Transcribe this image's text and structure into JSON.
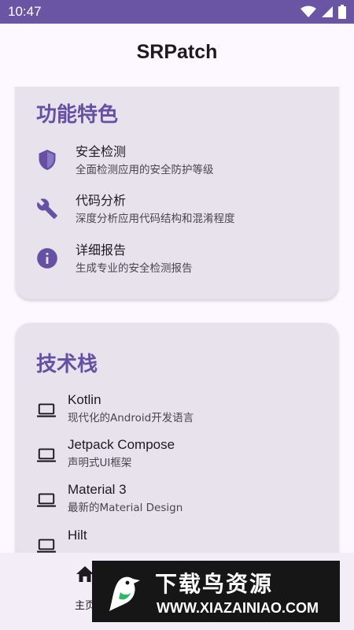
{
  "status_bar": {
    "time": "10:47",
    "icons": [
      "wifi-icon",
      "signal-icon",
      "battery-icon"
    ]
  },
  "app": {
    "title": "SRPatch"
  },
  "features_card": {
    "title": "功能特色",
    "items": [
      {
        "icon": "shield-icon",
        "title": "安全检测",
        "subtitle": "全面检测应用的安全防护等级"
      },
      {
        "icon": "wrench-icon",
        "title": "代码分析",
        "subtitle": "深度分析应用代码结构和混淆程度"
      },
      {
        "icon": "info-icon",
        "title": "详细报告",
        "subtitle": "生成专业的安全检测报告"
      }
    ]
  },
  "tech_card": {
    "title": "技术栈",
    "items": [
      {
        "icon": "laptop-icon",
        "title": "Kotlin",
        "subtitle": "现代化的Android开发语言"
      },
      {
        "icon": "laptop-icon",
        "title": "Jetpack Compose",
        "subtitle": "声明式UI框架"
      },
      {
        "icon": "laptop-icon",
        "title": "Material 3",
        "subtitle": "最新的Material Design"
      },
      {
        "icon": "laptop-icon",
        "title": "Hilt",
        "subtitle": ""
      }
    ]
  },
  "bottom_nav": {
    "items": [
      {
        "icon": "home-icon",
        "label": "主页"
      }
    ]
  },
  "watermark": {
    "title": "下载鸟资源",
    "url": "WWW.XIAZAINIAO.COM"
  },
  "colors": {
    "status_bar": "#6a55a4",
    "accent": "#6650a4",
    "card_bg": "#e8e2ec",
    "page_bg": "#fdf7ff",
    "nav_bg": "#f3edf7"
  }
}
